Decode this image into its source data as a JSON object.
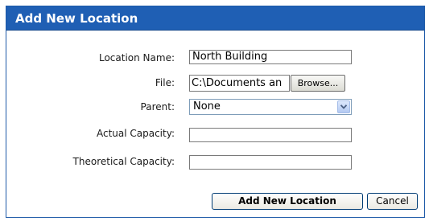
{
  "dialog": {
    "title": "Add New Location"
  },
  "form": {
    "location_name": {
      "label": "Location Name:",
      "value": "North Building"
    },
    "file": {
      "label": "File:",
      "value": "C:\\Documents an",
      "browse_label": "Browse..."
    },
    "parent": {
      "label": "Parent:",
      "selected": "None"
    },
    "actual_capacity": {
      "label": "Actual Capacity:",
      "value": ""
    },
    "theoretical_capacity": {
      "label": "Theoretical Capacity:",
      "value": ""
    }
  },
  "actions": {
    "submit_label": "Add New Location",
    "cancel_label": "Cancel"
  },
  "colors": {
    "titlebar": "#1f5fb4",
    "dialog_border": "#1e5aa8"
  },
  "icons": {
    "parent_dropdown": "chevron-down-icon"
  }
}
